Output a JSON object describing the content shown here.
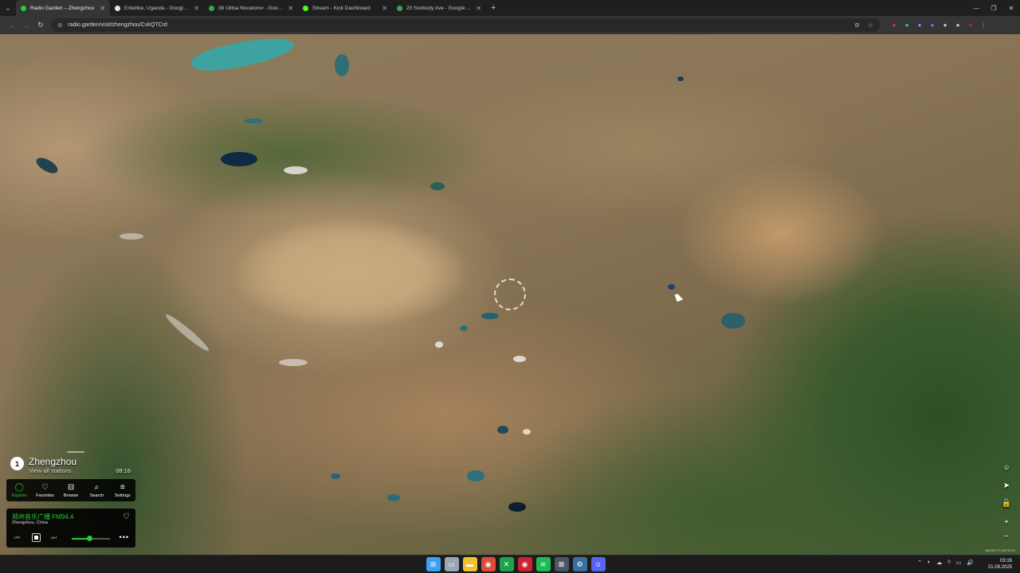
{
  "browser": {
    "tabs": [
      {
        "label": "Radio Garden – Zhengzhou",
        "favicon_color": "#27c93f",
        "active": true
      },
      {
        "label": "Entebbe, Uganda - Google'da A",
        "favicon_color": "#e8e8e8",
        "active": false
      },
      {
        "label": "36 Ulitsa Novatorov - Google M",
        "favicon_color": "#34a853",
        "active": false
      },
      {
        "label": "Stream - Kick Dashboard",
        "favicon_color": "#53fc18",
        "active": false
      },
      {
        "label": "20 Svobody Ave - Google Harita",
        "favicon_color": "#34a853",
        "active": false
      }
    ],
    "new_tab_icon": "plus-icon",
    "window_controls": [
      "minimize-icon",
      "restore-icon",
      "close-icon"
    ],
    "url": "radio.garden/visit/zhengzhou/CvkQTCrd",
    "omnibox_icons": [
      "eye-slash-icon",
      "star-icon"
    ],
    "extensions": [
      {
        "name": "record-icon",
        "color": "#e53935"
      },
      {
        "name": "translate-icon",
        "color": "#2ec4b6"
      },
      {
        "name": "audio-icon",
        "color": "#5aa0ff"
      },
      {
        "name": "shield-icon",
        "color": "#4f8df5"
      },
      {
        "name": "window-icon",
        "color": "#cccccc"
      },
      {
        "name": "puzzle-icon",
        "color": "#cccccc"
      },
      {
        "name": "profile-icon",
        "color": "#c62828"
      },
      {
        "name": "menu-icon",
        "color": "#cccccc"
      }
    ]
  },
  "city": {
    "badge": "1",
    "name": "Zhengzhou",
    "subtitle": "View all stations",
    "local_time": "08:16"
  },
  "nav": [
    {
      "label": "Explore",
      "icon": "explore-icon",
      "glyph": "◯",
      "active": true
    },
    {
      "label": "Favorites",
      "icon": "heart-icon",
      "glyph": "♡",
      "active": false
    },
    {
      "label": "Browse",
      "icon": "map-icon",
      "glyph": "⊟",
      "active": false
    },
    {
      "label": "Search",
      "icon": "search-icon",
      "glyph": "⌕",
      "active": false
    },
    {
      "label": "Settings",
      "icon": "settings-icon",
      "glyph": "≡",
      "active": false
    }
  ],
  "player": {
    "station": "郑州音乐广播 FM94.4",
    "location": "Zhengzhou, China",
    "volume": 0.45,
    "accent_color": "#27c93f"
  },
  "map_controls": [
    {
      "name": "pin-icon",
      "glyph": "⌾"
    },
    {
      "name": "locate-icon",
      "glyph": "➤"
    },
    {
      "name": "lock-icon",
      "glyph": "🔒"
    },
    {
      "name": "zoom-in-icon",
      "glyph": "+"
    },
    {
      "name": "zoom-out-icon",
      "glyph": "−"
    }
  ],
  "attribution": "IMAGERY © MAPTILER",
  "taskbar": {
    "apps": [
      {
        "name": "windows-start-icon",
        "glyph": "⊞",
        "color": "#3aa0f3"
      },
      {
        "name": "task-view-icon",
        "glyph": "▭",
        "color": "#9aa4b4"
      },
      {
        "name": "file-explorer-icon",
        "glyph": "▬",
        "color": "#f2c12e"
      },
      {
        "name": "chrome-icon",
        "glyph": "◉",
        "color": "#e04a3c"
      },
      {
        "name": "xbox-icon",
        "glyph": "✕",
        "color": "#1fa14b"
      },
      {
        "name": "opera-icon",
        "glyph": "◉",
        "color": "#cc2233"
      },
      {
        "name": "spotify-icon",
        "glyph": "≋",
        "color": "#1db954"
      },
      {
        "name": "capture-icon",
        "glyph": "⊠",
        "color": "#4d5563"
      },
      {
        "name": "steam-icon",
        "glyph": "⚙",
        "color": "#3b6fa0"
      },
      {
        "name": "discord-icon",
        "glyph": "☺",
        "color": "#5865f2"
      }
    ],
    "tray": [
      "chevron-up-icon",
      "color-icon",
      "cloud-icon",
      "mic-icon",
      "network-icon",
      "volume-icon"
    ],
    "tray_glyphs": [
      "⌃",
      "◐",
      "☁",
      "◊",
      "▭",
      "🔊"
    ],
    "time": "03:16",
    "date": "21.08.2025"
  }
}
